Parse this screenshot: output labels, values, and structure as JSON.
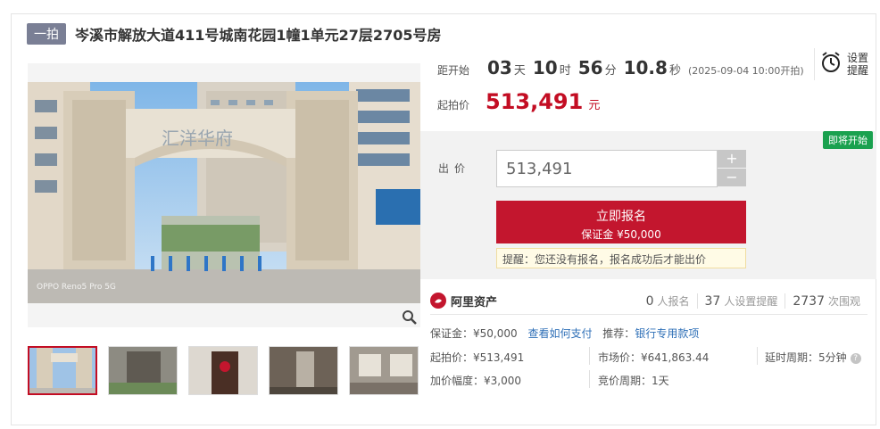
{
  "header": {
    "badge": "一拍",
    "title": "岑溪市解放大道411号城南花园1幢1单元27层2705号房"
  },
  "countdown": {
    "label": "距开始",
    "days": "03",
    "days_unit": "天",
    "hours": "10",
    "hours_unit": "时",
    "minutes": "56",
    "minutes_unit": "分",
    "seconds": "10.8",
    "seconds_unit": "秒",
    "note": "(2025-09-04 10:00开拍)"
  },
  "remind": {
    "line1": "设置",
    "line2": "提醒"
  },
  "start_price": {
    "label": "起拍价",
    "value": "513,491",
    "unit": "元"
  },
  "bid": {
    "status_tag": "即将开始",
    "label": "出价",
    "input_value": "513,491",
    "plus": "+",
    "minus": "−",
    "signup_label": "立即报名",
    "deposit_label": "保证金 ¥50,000",
    "tip": "提醒：您还没有报名，报名成功后才能出价"
  },
  "platform": {
    "name": "阿里资产",
    "signups_n": "0",
    "signups_l": "人报名",
    "reminders_n": "37",
    "reminders_l": "人设置提醒",
    "views_n": "2737",
    "views_l": "次围观"
  },
  "details": {
    "deposit": "保证金：¥50,000",
    "how_to_pay": "查看如何支付",
    "recommend_label": "推荐：",
    "recommend_link": "银行专用款项",
    "start_price": "起拍价：¥513,491",
    "market_price": "市场价：¥641,863.44",
    "delay_period": "延时周期：5分钟",
    "increment": "加价幅度：¥3,000",
    "bid_period": "竞价周期：1天"
  },
  "gallery": {
    "thumb_count": 5,
    "photo_watermark": "OPPO Reno5 Pro 5G",
    "building_sign": "汇洋华府"
  },
  "colors": {
    "accent": "#c30d23",
    "link": "#2e6fb7",
    "tag_green": "#1aa14f"
  }
}
